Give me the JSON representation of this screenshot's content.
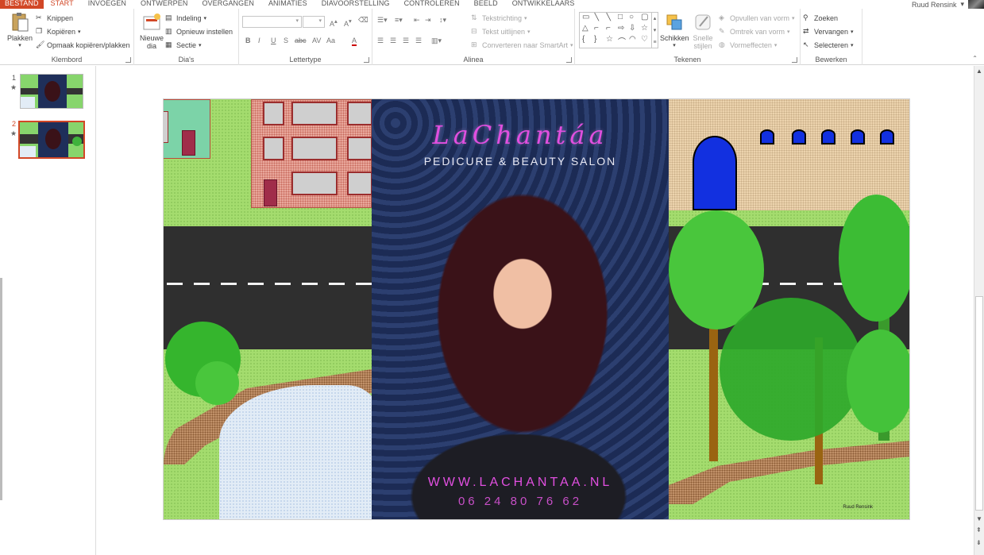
{
  "tabs": {
    "file": "BESTAND",
    "start": "START",
    "insert": "INVOEGEN",
    "design": "ONTWERPEN",
    "transitions": "OVERGANGEN",
    "animations": "ANIMATIES",
    "slideshow": "DIAVOORSTELLING",
    "review": "CONTROLEREN",
    "view": "BEELD",
    "developer": "ONTWIKKELAARS"
  },
  "user": {
    "name": "Ruud Rensink"
  },
  "ribbon": {
    "clipboard": {
      "label": "Klembord",
      "paste": "Plakken",
      "cut": "Knippen",
      "copy": "Kopiëren",
      "format_painter": "Opmaak kopiëren/plakken"
    },
    "slides": {
      "label": "Dia's",
      "new_slide_1": "Nieuwe",
      "new_slide_2": "dia",
      "layout": "Indeling",
      "reset": "Opnieuw instellen",
      "section": "Sectie"
    },
    "font": {
      "label": "Lettertype",
      "bold": "B",
      "italic": "I",
      "underline": "U",
      "shadow": "S",
      "strike": "abc",
      "spacing": "AV",
      "case": "Aa",
      "color": "A"
    },
    "paragraph": {
      "label": "Alinea",
      "text_direction": "Tekstrichting",
      "align_text": "Tekst uitlijnen",
      "smartart": "Converteren naar SmartArt"
    },
    "drawing": {
      "label": "Tekenen",
      "arrange": "Schikken",
      "quick_styles_1": "Snelle",
      "quick_styles_2": "stijlen",
      "fill": "Opvullen van vorm",
      "outline": "Omtrek van vorm",
      "effects": "Vormeffecten"
    },
    "editing": {
      "label": "Bewerken",
      "find": "Zoeken",
      "replace": "Vervangen",
      "select": "Selecteren"
    }
  },
  "slides_pane": {
    "slides": [
      {
        "number": "1",
        "mark": "★"
      },
      {
        "number": "2",
        "mark": "★",
        "selected": true
      }
    ]
  },
  "slide": {
    "brand": "LaChantáa",
    "tagline": "PEDICURE & BEAUTY SALON",
    "website": "WWW.LACHANTAA.NL",
    "phone": "06 24 80 76 62",
    "credit": "Ruud Rensink"
  },
  "colors": {
    "accent": "#d24726",
    "brand_pink": "#e14fe0"
  }
}
